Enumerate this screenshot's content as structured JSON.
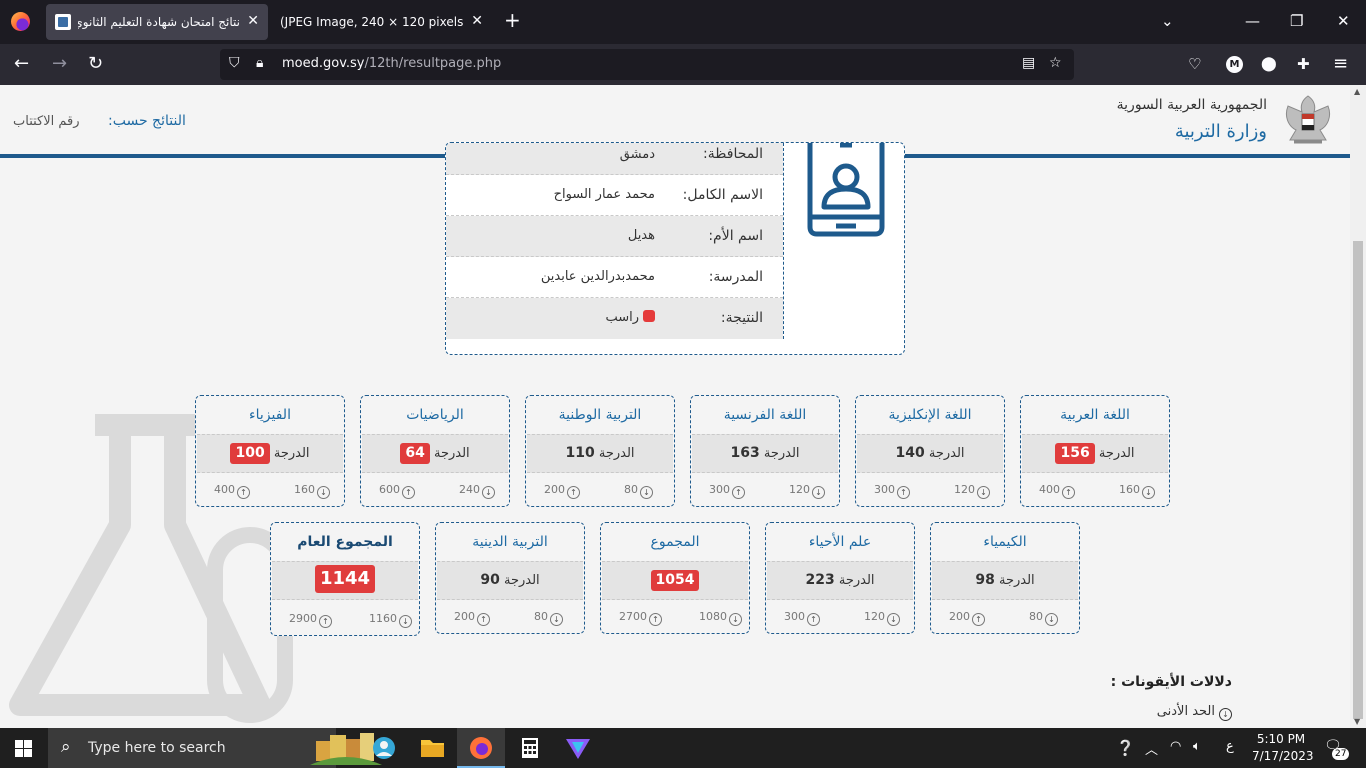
{
  "browser": {
    "tabs": [
      {
        "title": "نتائج امتحان شهادة التعليم الثانوي",
        "active": true
      },
      {
        "title": "(JPEG Image, 240 × 120 pixels)",
        "active": false
      }
    ],
    "url_host": "moed.gov.sy",
    "url_path": "/12th/resultpage.php",
    "profile_initial": "M"
  },
  "header": {
    "republic": "الجمهورية العربية السورية",
    "ministry": "وزارة التربية",
    "results_by_label": "النتائج حسب:",
    "results_by_value": "رقم الاكتتاب"
  },
  "student": {
    "governorate_label": "المحافظة:",
    "governorate": "دمشق",
    "fullname_label": "الاسم الكامل:",
    "fullname": "محمد عمار السواح",
    "mother_label": "اسم الأم:",
    "mother": "هديل",
    "school_label": "المدرسة:",
    "school": "محمدبدرالدين عابدين",
    "result_label": "النتيجة:",
    "result": "راسب"
  },
  "grade_word": "الدرجة",
  "subjects_row1": [
    {
      "name": "اللغة العربية",
      "grade": "156",
      "failed": true,
      "min": "160",
      "max": "400"
    },
    {
      "name": "اللغة الإنكليزية",
      "grade": "140",
      "failed": false,
      "min": "120",
      "max": "300"
    },
    {
      "name": "اللغة الفرنسية",
      "grade": "163",
      "failed": false,
      "min": "120",
      "max": "300"
    },
    {
      "name": "التربية الوطنية",
      "grade": "110",
      "failed": false,
      "min": "80",
      "max": "200"
    },
    {
      "name": "الرياضيات",
      "grade": "64",
      "failed": true,
      "min": "240",
      "max": "600"
    },
    {
      "name": "الفيزياء",
      "grade": "100",
      "failed": true,
      "min": "160",
      "max": "400"
    }
  ],
  "subjects_row2": [
    {
      "name": "الكيمياء",
      "grade": "98",
      "failed": false,
      "min": "80",
      "max": "200"
    },
    {
      "name": "علم الأحياء",
      "grade": "223",
      "failed": false,
      "min": "120",
      "max": "300"
    },
    {
      "name": "المجموع",
      "grade": "1054",
      "failed": true,
      "min": "1080",
      "max": "2700"
    },
    {
      "name": "التربية الدينية",
      "grade": "90",
      "failed": false,
      "min": "80",
      "max": "200"
    },
    {
      "name": "المجموع العام",
      "grade": "1144",
      "failed": true,
      "min": "1160",
      "max": "2900"
    }
  ],
  "legend": {
    "title": "دلالات الأيقونات :",
    "min_label": "الحد الأدنى"
  },
  "taskbar": {
    "search_placeholder": "Type here to search",
    "time": "5:10 PM",
    "date": "7/17/2023",
    "lang": "ع",
    "notifications": "27"
  }
}
